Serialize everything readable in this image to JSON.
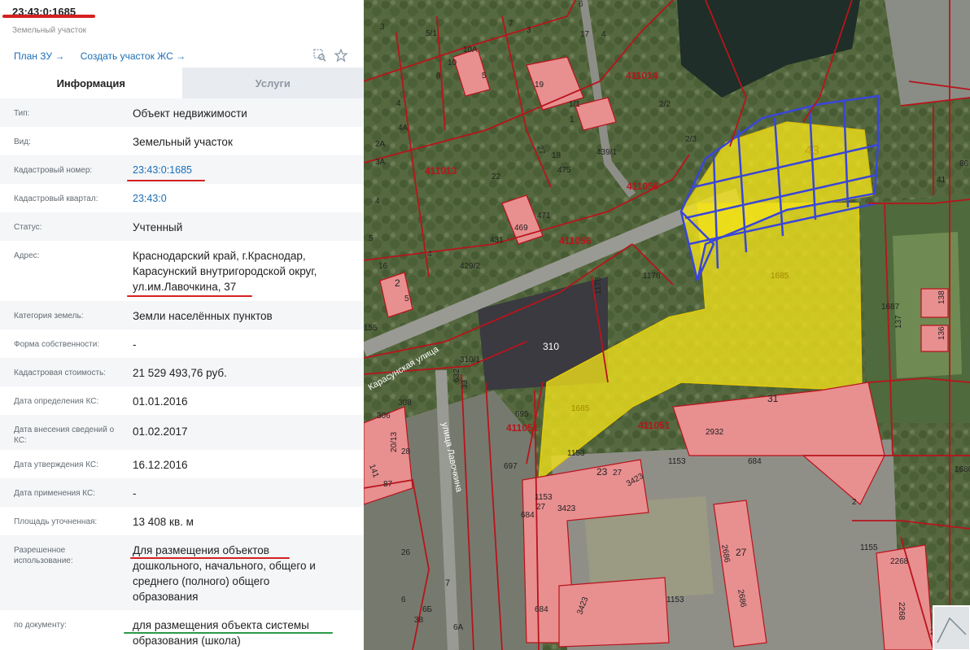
{
  "header": {
    "cadastral_number": "23:43:0:1685",
    "object_kind": "Земельный участок"
  },
  "actions": {
    "plan_link": "План ЗУ →",
    "create_link": "Создать участок ЖС →"
  },
  "tabs": [
    {
      "label": "Информация",
      "active": true
    },
    {
      "label": "Услуги",
      "active": false
    }
  ],
  "fields": [
    {
      "label": "Тип:",
      "value": "Объект недвижимости"
    },
    {
      "label": "Вид:",
      "value": "Земельный участок"
    },
    {
      "label": "Кадастровый номер:",
      "value": "23:43:0:1685",
      "link": true
    },
    {
      "label": "Кадастровый квартал:",
      "value": "23:43:0",
      "link": true
    },
    {
      "label": "Статус:",
      "value": "Учтенный"
    },
    {
      "label": "Адрес:",
      "value_lines": [
        "Краснодарский край, г.Краснодар,",
        "Карасунский внутригородской округ,",
        "ул.им.Лавочкина, 37"
      ]
    },
    {
      "label": "Категория земель:",
      "value": "Земли населённых пунктов"
    },
    {
      "label": "Форма собственности:",
      "value": "-"
    },
    {
      "label": "Кадастровая стоимость:",
      "value": "21 529 493,76 руб."
    },
    {
      "label": "Дата определения КС:",
      "value": "01.01.2016"
    },
    {
      "label": "Дата внесения сведений о КС:",
      "value": "01.02.2017"
    },
    {
      "label": "Дата утверждения КС:",
      "value": "16.12.2016"
    },
    {
      "label": "Дата применения КС:",
      "value": "-"
    },
    {
      "label": "Площадь уточненная:",
      "value": "13 408 кв. м"
    },
    {
      "label": "Разрешенное использование:",
      "value_lines": [
        "Для размещения объектов",
        "дошкольного, начального, общего и",
        "среднего (полного) общего",
        "образования"
      ]
    },
    {
      "label": "по документу:",
      "value_lines": [
        "для размещения объекта системы",
        "образования (школа)"
      ]
    }
  ],
  "map": {
    "quarters": [
      "411014",
      "411013",
      "411056",
      "411056",
      "411051",
      "411051"
    ],
    "parcel_labels": [
      "43",
      "1685",
      "1685",
      "1178",
      "1178",
      "1687",
      "137",
      "138",
      "136",
      "31",
      "2932",
      "684",
      "23",
      "27",
      "3423",
      "1153",
      "1153",
      "1153",
      "684",
      "3423",
      "2686",
      "27",
      "2686",
      "1155",
      "2268",
      "2268",
      "2",
      "1680",
      "29",
      "41",
      "86",
      "310",
      "310/1",
      "33",
      "632",
      "308",
      "306",
      "20/13",
      "28",
      "87",
      "141",
      "695",
      "697",
      "684",
      "27",
      "1153",
      "3423",
      "26",
      "6",
      "6Б",
      "6А",
      "38",
      "7",
      "5",
      "16",
      "2",
      "4",
      "429/2",
      "431",
      "469",
      "471",
      "475",
      "439/1",
      "18",
      "27",
      "22",
      "1/1",
      "19",
      "1",
      "2/2",
      "2/3",
      "17",
      "4",
      "5",
      "3",
      "6",
      "7",
      "10",
      "10А",
      "5/1",
      "8",
      "4",
      "3",
      "4А",
      "2А",
      "3А",
      "4",
      "155",
      "5"
    ],
    "street_labels": [
      "Карасунская улица",
      "улица Лавочкина"
    ],
    "colors": {
      "aerial_base": "#5f6c4d",
      "parcel_yellow": "#f2e21a",
      "grid_blue": "#3a46d8",
      "boundary_red": "#b8141c",
      "building_pink": "#e88f90"
    }
  }
}
